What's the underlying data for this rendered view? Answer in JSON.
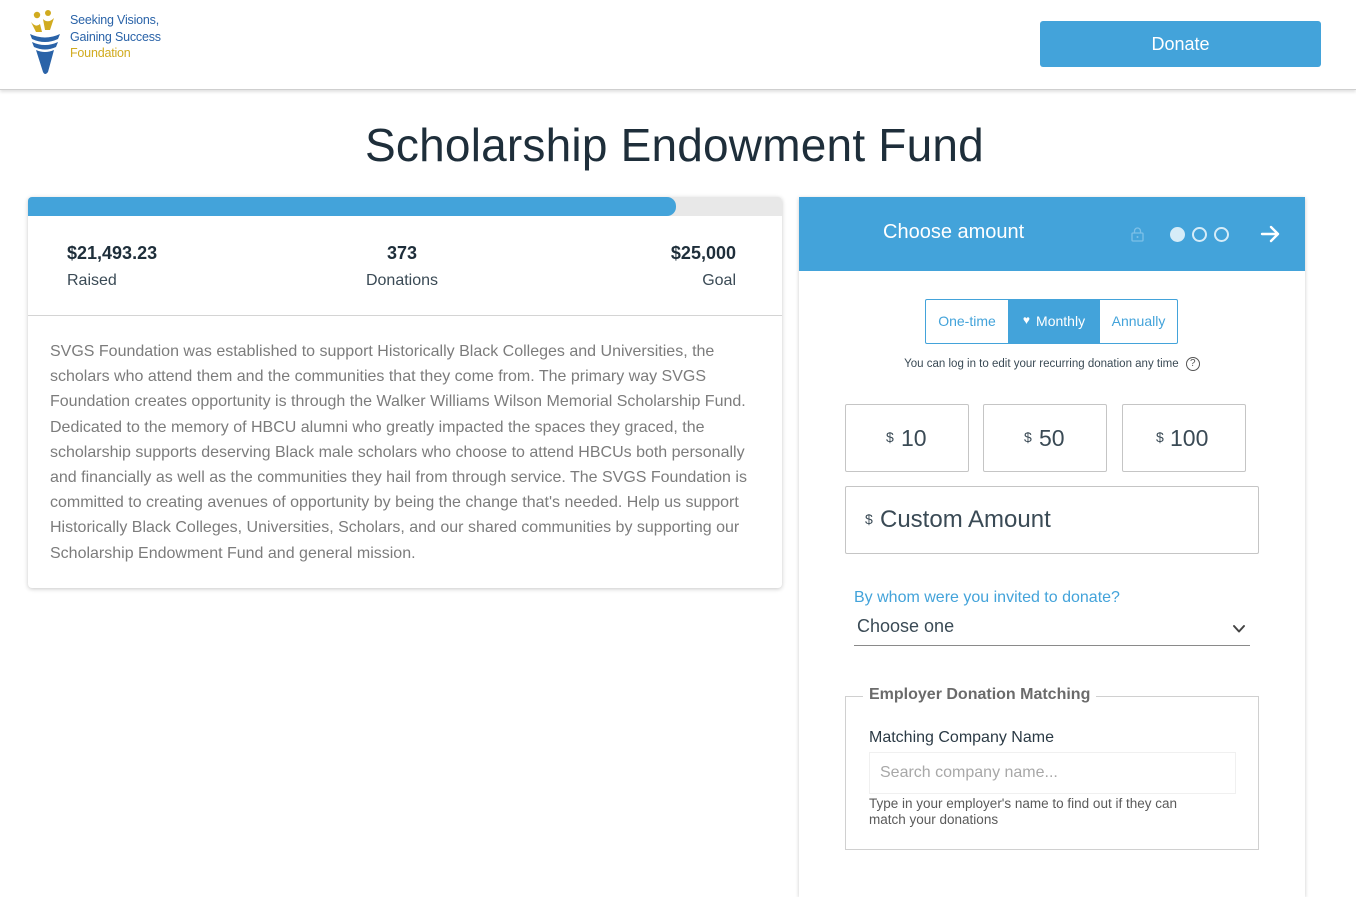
{
  "header": {
    "logo": {
      "line1": "Seeking Visions,",
      "line2": "Gaining Success",
      "line3": "Foundation"
    },
    "donate_label": "Donate"
  },
  "page": {
    "title": "Scholarship Endowment Fund"
  },
  "campaign": {
    "progress": 0.86,
    "raised": {
      "value": "$21,493.23",
      "label": "Raised"
    },
    "donations": {
      "value": "373",
      "label": "Donations"
    },
    "goal": {
      "value": "$25,000",
      "label": "Goal"
    },
    "description": "SVGS Foundation was established to support Historically Black Colleges and Universities, the scholars who attend them and the communities that they come from. The primary way SVGS Foundation creates opportunity is through the Walker Williams Wilson Memorial Scholarship Fund. Dedicated to the memory of HBCU alumni who greatly impacted the spaces they graced, the scholarship supports deserving Black male scholars who choose to attend HBCUs both personally and financially as well as the communities they hail from through service. The SVGS Foundation is committed to creating avenues of opportunity by being the change that's needed. Help us support Historically Black Colleges, Universities, Scholars, and our shared communities by supporting our Scholarship Endowment Fund and general mission."
  },
  "donation_form": {
    "header": {
      "title": "Choose amount",
      "steps": 3,
      "current_step": 1
    },
    "frequency": {
      "options": [
        "One-time",
        "Monthly",
        "Annually"
      ],
      "selected": "Monthly"
    },
    "recurring_note": "You can log in to edit your recurring donation any time",
    "help_symbol": "?",
    "currency_symbol": "$",
    "amounts": [
      "10",
      "50",
      "100"
    ],
    "custom_amount_placeholder": "Custom Amount",
    "invite": {
      "label": "By whom were you invited to donate?",
      "value": "Choose one"
    },
    "matching": {
      "legend": "Employer Donation Matching",
      "company_label": "Matching Company Name",
      "company_placeholder": "Search company name...",
      "help": "Type in your employer's name to find out if they can match your donations"
    }
  },
  "colors": {
    "accent": "#43a3da",
    "logo_blue": "#2a63a8",
    "logo_gold": "#d1ab1f",
    "title": "#1e2e3a"
  },
  "icons": [
    "logo-mark",
    "lock-icon",
    "arrow-right-icon",
    "heart-icon",
    "help-icon",
    "chevron-down-icon"
  ]
}
